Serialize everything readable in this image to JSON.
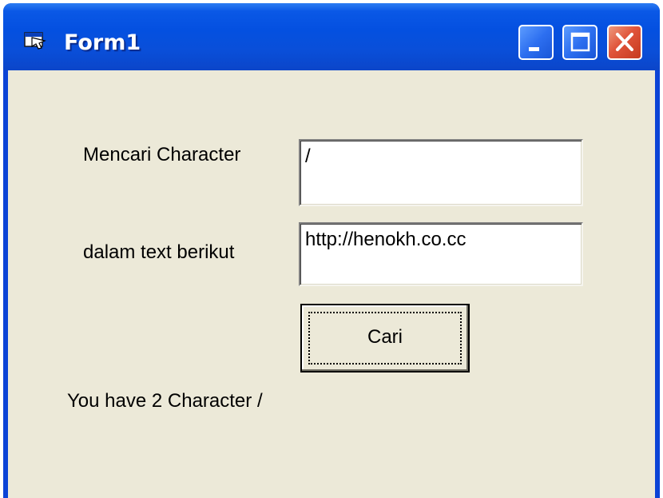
{
  "window": {
    "title": "Form1",
    "icon": "form-window-icon",
    "controls": [
      "minimize-icon",
      "maximize-icon",
      "close-icon"
    ]
  },
  "form": {
    "search_char_label": "Mencari Character",
    "search_char_value": "/",
    "text_label": "dalam text berikut",
    "text_value": "http://henokh.co.cc",
    "search_button_label": "Cari",
    "result_text": "You have 2 Character /"
  },
  "colors": {
    "titlebar": "#0a58e6",
    "client_background": "#ece9d8",
    "close_button": "#e0543a"
  }
}
